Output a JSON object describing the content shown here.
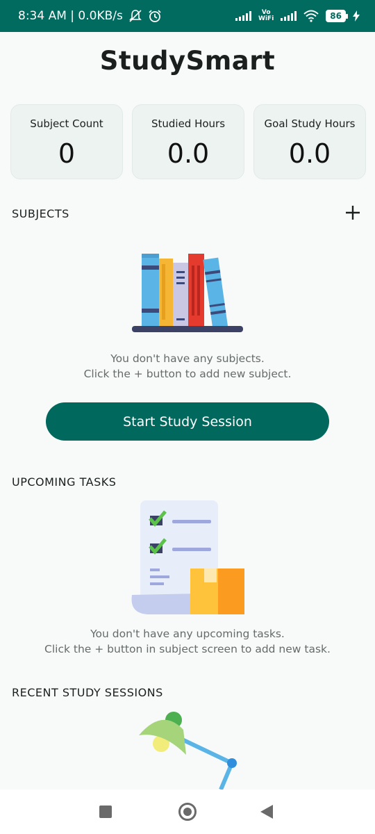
{
  "status_bar": {
    "time_and_speed": "8:34 AM | 0.0KB/s",
    "volte": "Vo WiFi",
    "battery": "86"
  },
  "app": {
    "title": "StudySmart"
  },
  "stats": [
    {
      "label": "Subject Count",
      "value": "0"
    },
    {
      "label": "Studied Hours",
      "value": "0.0"
    },
    {
      "label": "Goal Study Hours",
      "value": "0.0"
    }
  ],
  "subjects": {
    "header": "SUBJECTS",
    "add_icon": "plus-icon",
    "empty_line1": "You don't have any subjects.",
    "empty_line2": "Click the + button to add new subject."
  },
  "start_button": {
    "label": "Start Study Session"
  },
  "tasks": {
    "header": "UPCOMING TASKS",
    "empty_line1": "You don't have any upcoming tasks.",
    "empty_line2": "Click the + button in subject screen to add new task."
  },
  "sessions": {
    "header": "RECENT STUDY SESSIONS"
  },
  "colors": {
    "primary": "#00685d",
    "status_bar": "#006b5e",
    "background": "#f7faf9"
  },
  "nav": {
    "icons": [
      "square-recents-icon",
      "circle-home-icon",
      "triangle-back-icon"
    ]
  }
}
